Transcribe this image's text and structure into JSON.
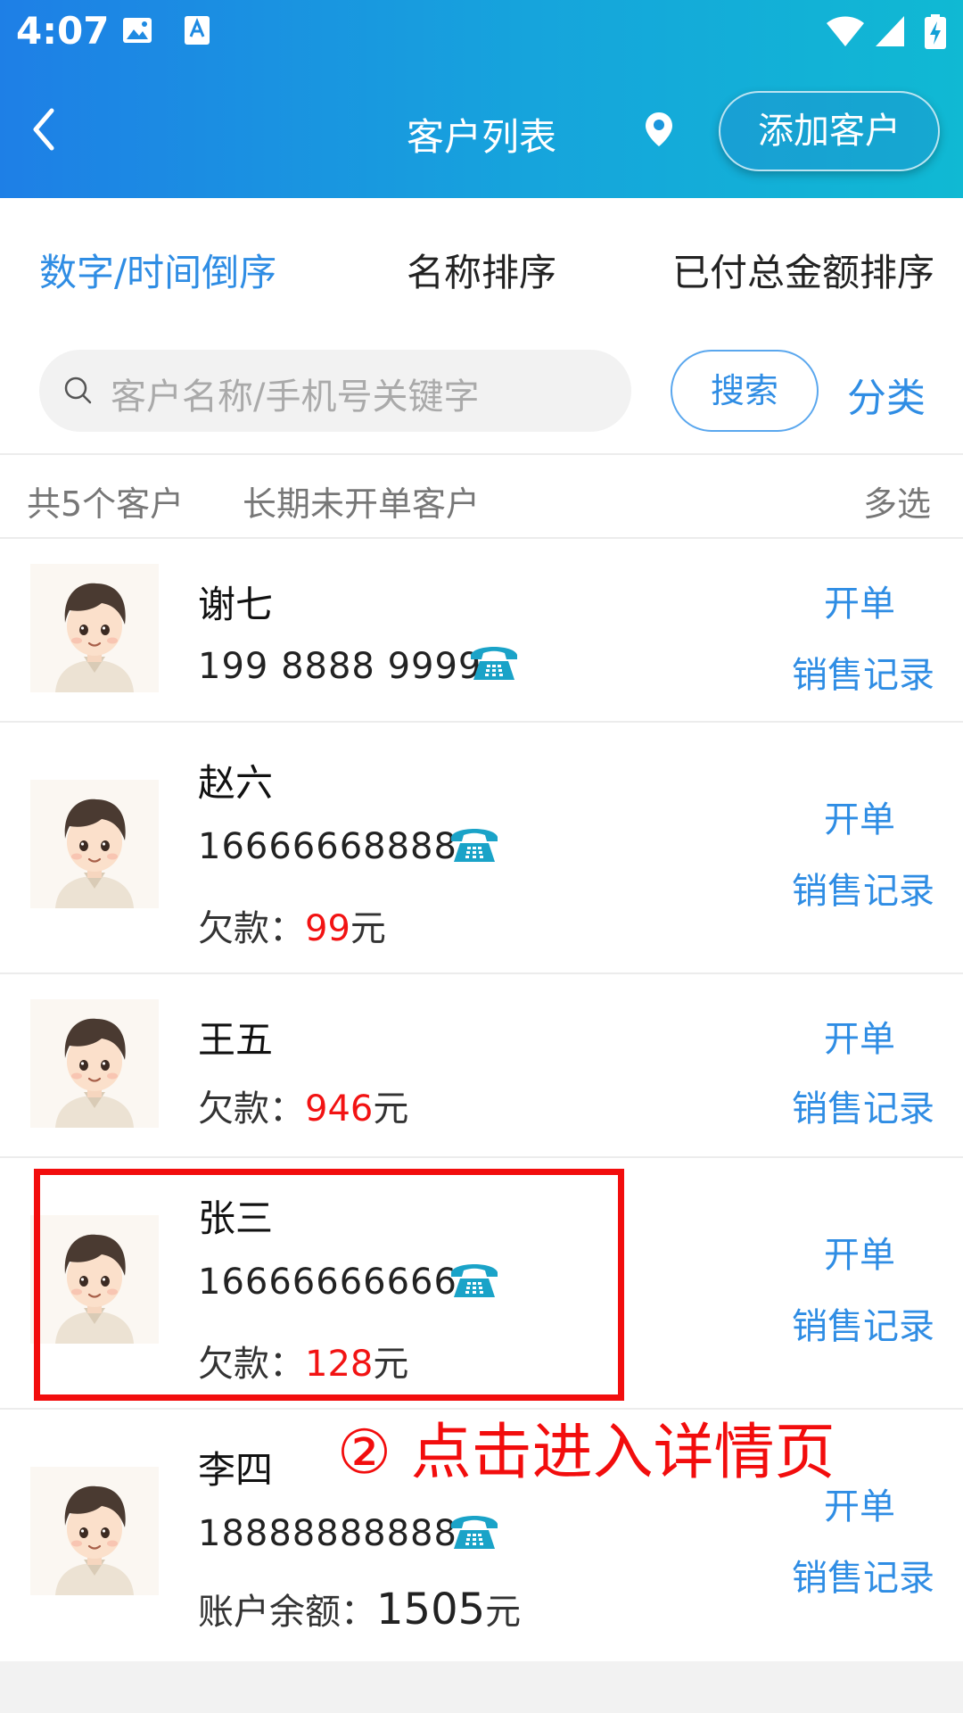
{
  "status_bar": {
    "time": "4:07"
  },
  "header": {
    "title": "客户列表",
    "add_button": "添加客户"
  },
  "sort_tabs": [
    "数字/时间倒序",
    "名称排序",
    "已付总金额排序"
  ],
  "search": {
    "placeholder": "客户名称/手机号关键字",
    "button": "搜索",
    "category": "分类"
  },
  "summary": {
    "count": "共5个客户",
    "inactive": "长期未开单客户",
    "multi": "多选"
  },
  "labels": {
    "open_order": "开单",
    "sales_record": "销售记录",
    "debt": "欠款：",
    "balance": "账户余额：",
    "yuan": "元"
  },
  "customers": [
    {
      "name": "谢七",
      "phone": "199 8888 9999"
    },
    {
      "name": "赵六",
      "phone": "16666668888",
      "debt": "99"
    },
    {
      "name": "王五",
      "debt": "946"
    },
    {
      "name": "张三",
      "phone": "16666666666",
      "debt": "128"
    },
    {
      "name": "李四",
      "phone": "18888888888",
      "balance": "1505"
    }
  ],
  "annotation": "② 点击进入详情页",
  "colors": {
    "accent": "#2f8de4",
    "header_start": "#1e7fe6",
    "header_end": "#10b9d3",
    "debt": "#f21313",
    "highlight": "#f20d0d"
  }
}
